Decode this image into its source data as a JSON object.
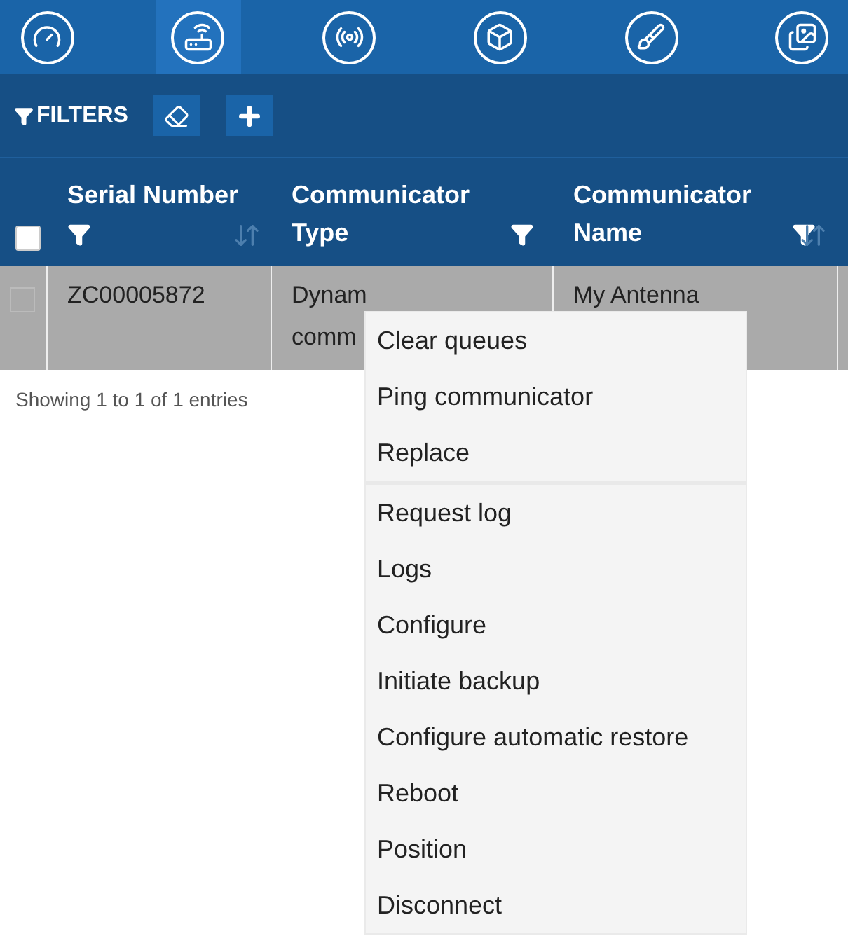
{
  "nav_tabs": [
    {
      "selected": false
    },
    {
      "selected": true
    },
    {
      "selected": false
    },
    {
      "selected": false
    },
    {
      "selected": false
    },
    {
      "selected": false
    }
  ],
  "filters": {
    "label": "FILTERS"
  },
  "table": {
    "select_all_checked": false,
    "columns": [
      {
        "title": "Serial Number",
        "sort": true
      },
      {
        "title": "Communicator Type",
        "sort": false
      },
      {
        "title": "Communicator Name",
        "sort": true
      }
    ],
    "rows": [
      {
        "checked": false,
        "cells": [
          [
            "ZC00005872"
          ],
          [
            "Dynam",
            "comm"
          ],
          [
            "My Antenna"
          ]
        ]
      }
    ]
  },
  "footer": "Showing 1 to 1 of 1 entries",
  "context_menu": {
    "groups": [
      [
        "Clear queues",
        "Ping communicator",
        "Replace"
      ],
      [
        "Request log",
        "Logs",
        "Configure",
        "Initiate backup",
        "Configure automatic restore",
        "Reboot",
        "Position",
        "Disconnect"
      ]
    ]
  }
}
